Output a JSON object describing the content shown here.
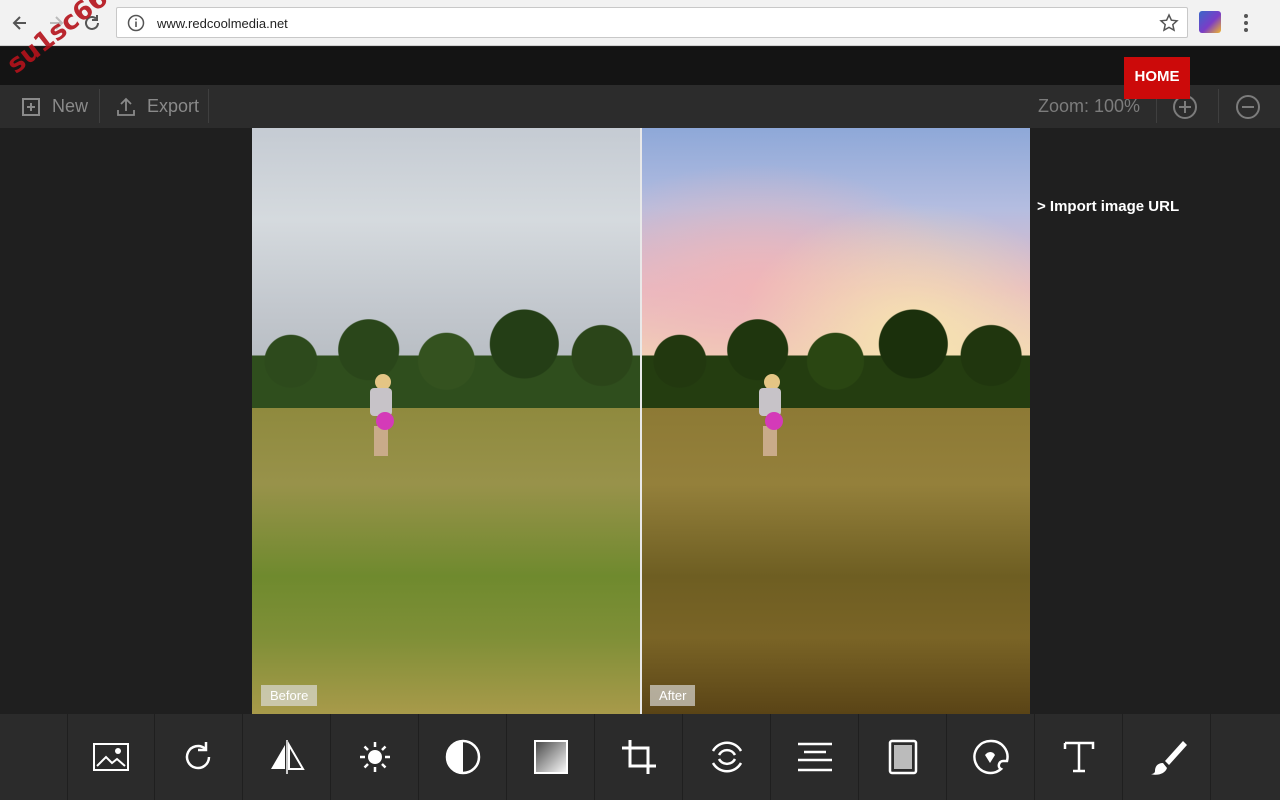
{
  "browser": {
    "url": "www.redcoolmedia.net"
  },
  "watermark": "su1sc66",
  "toolbar": {
    "new_label": "New",
    "export_label": "Export",
    "zoom_label": "Zoom: 100%"
  },
  "home_label": "HOME",
  "import_label": "> Import image URL",
  "photos": {
    "before_label": "Before",
    "after_label": "After"
  },
  "tools": [
    {
      "name": "image-icon"
    },
    {
      "name": "rotate-icon"
    },
    {
      "name": "flip-icon"
    },
    {
      "name": "brightness-icon"
    },
    {
      "name": "contrast-icon"
    },
    {
      "name": "gradient-icon"
    },
    {
      "name": "crop-icon"
    },
    {
      "name": "focus-icon"
    },
    {
      "name": "align-icon"
    },
    {
      "name": "frame-icon"
    },
    {
      "name": "sticker-icon"
    },
    {
      "name": "text-icon"
    },
    {
      "name": "brush-icon"
    }
  ],
  "colors": {
    "home_bg": "#cc0a0a",
    "toolbar_bg": "#2c2c2c",
    "workspace_bg": "#1f1f1f"
  }
}
